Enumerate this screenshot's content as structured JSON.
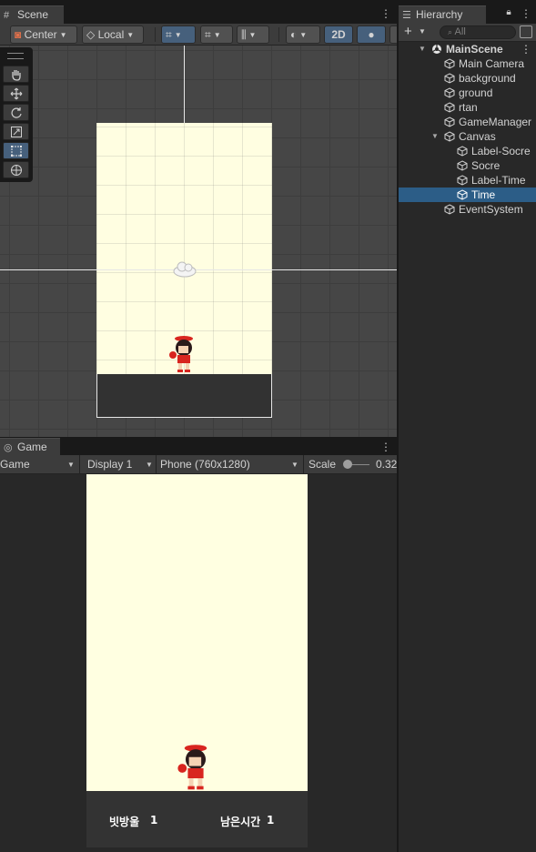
{
  "scene": {
    "tab_label": "Scene",
    "tab_icon": "grid-icon",
    "toolbar": {
      "pivot_label": "Center",
      "space_label": "Local",
      "toggle_2d_label": "2D"
    },
    "tools": [
      "hand-tool-icon",
      "move-tool-icon",
      "rotate-tool-icon",
      "scale-tool-icon",
      "rect-tool-icon",
      "transform-tool-icon"
    ],
    "active_tool": "rect-tool-icon"
  },
  "game": {
    "tab_label": "Game",
    "tab_icon": "gamepad-icon",
    "toolbar": {
      "view_mode": "Game",
      "display": "Display 1",
      "resolution": "Phone (760x1280)",
      "scale_label": "Scale",
      "scale_value": "0.32"
    },
    "hud": {
      "score_label": "빗방울",
      "score_value": "1",
      "time_label": "남은시간",
      "time_value": "1"
    }
  },
  "hierarchy": {
    "tab_label": "Hierarchy",
    "search_placeholder": "All",
    "items": [
      {
        "label": "MainScene",
        "depth": 0,
        "type": "scene",
        "expanded": true
      },
      {
        "label": "Main Camera",
        "depth": 1,
        "type": "object"
      },
      {
        "label": "background",
        "depth": 1,
        "type": "object"
      },
      {
        "label": "ground",
        "depth": 1,
        "type": "object"
      },
      {
        "label": "rtan",
        "depth": 1,
        "type": "object"
      },
      {
        "label": "GameManager",
        "depth": 1,
        "type": "object"
      },
      {
        "label": "Canvas",
        "depth": 1,
        "type": "object",
        "expanded": true
      },
      {
        "label": "Label-Socre",
        "depth": 2,
        "type": "object"
      },
      {
        "label": "Socre",
        "depth": 2,
        "type": "object"
      },
      {
        "label": "Label-Time",
        "depth": 2,
        "type": "object"
      },
      {
        "label": "Time",
        "depth": 2,
        "type": "object",
        "selected": true
      },
      {
        "label": "EventSystem",
        "depth": 1,
        "type": "object"
      }
    ]
  },
  "colors": {
    "accent_selected": "#2c5d87",
    "active_button": "#46607c",
    "game_background": "#ffffe1",
    "ground": "#333333"
  }
}
